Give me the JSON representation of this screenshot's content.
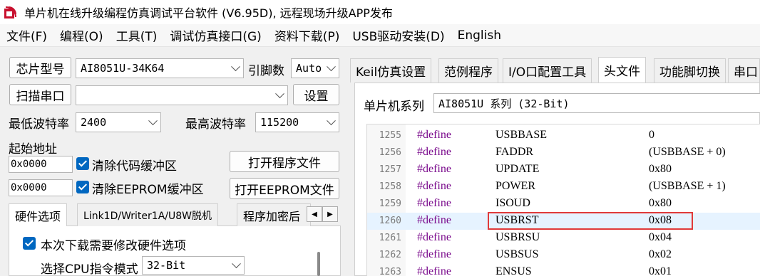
{
  "window": {
    "title": "单片机在线升级编程仿真调试平台软件 (V6.95D), 远程现场升级APP发布"
  },
  "menu": [
    "文件(F)",
    "编程(O)",
    "工具(T)",
    "调试仿真接口(G)",
    "资料下载(P)",
    "USB驱动安装(D)",
    "English"
  ],
  "left": {
    "chip_button": "芯片型号",
    "chip_value": "AI8051U-34K64",
    "pins_label": "引脚数",
    "pins_value": "Auto",
    "scan_button": "扫描串口",
    "port_value": "",
    "settings_button": "设置",
    "min_baud_label": "最低波特率",
    "min_baud_value": "2400",
    "max_baud_label": "最高波特率",
    "max_baud_value": "115200",
    "start_addr_label": "起始地址",
    "code_addr": "0x0000",
    "clear_code_label": "清除代码缓冲区",
    "open_program_button": "打开程序文件",
    "eeprom_addr": "0x0000",
    "clear_eeprom_label": "清除EEPROM缓冲区",
    "open_eeprom_button": "打开EEPROM文件",
    "tabs": [
      "硬件选项",
      "Link1D/Writer1A/U8W脱机",
      "程序加密后"
    ],
    "hw_option_label": "本次下载需要修改硬件选项",
    "cpu_mode_label": "选择CPU指令模式",
    "cpu_mode_value": "32-Bit"
  },
  "right": {
    "tabs": [
      "Keil仿真设置",
      "范例程序",
      "I/O口配置工具",
      "头文件",
      "功能脚切换",
      "串口"
    ],
    "active_tab": "头文件",
    "series_label": "单片机系列",
    "series_value": "AI8051U 系列 (32-Bit)",
    "code_lines": [
      {
        "ln": "1255",
        "kw": "#define",
        "name": "USBBASE",
        "value": "0"
      },
      {
        "ln": "1256",
        "kw": "#define",
        "name": "FADDR",
        "value": "(USBBASE + 0)"
      },
      {
        "ln": "1257",
        "kw": "#define",
        "name": "UPDATE",
        "value": "0x80"
      },
      {
        "ln": "1258",
        "kw": "#define",
        "name": "POWER",
        "value": "(USBBASE + 1)"
      },
      {
        "ln": "1259",
        "kw": "#define",
        "name": "ISOUD",
        "value": "0x80"
      },
      {
        "ln": "1260",
        "kw": "#define",
        "name": "USBRST",
        "value": "0x08"
      },
      {
        "ln": "1261",
        "kw": "#define",
        "name": "USBRSU",
        "value": "0x04"
      },
      {
        "ln": "1262",
        "kw": "#define",
        "name": "USBSUS",
        "value": "0x02"
      },
      {
        "ln": "1263",
        "kw": "#define",
        "name": "ENSUS",
        "value": "0x01"
      }
    ]
  }
}
